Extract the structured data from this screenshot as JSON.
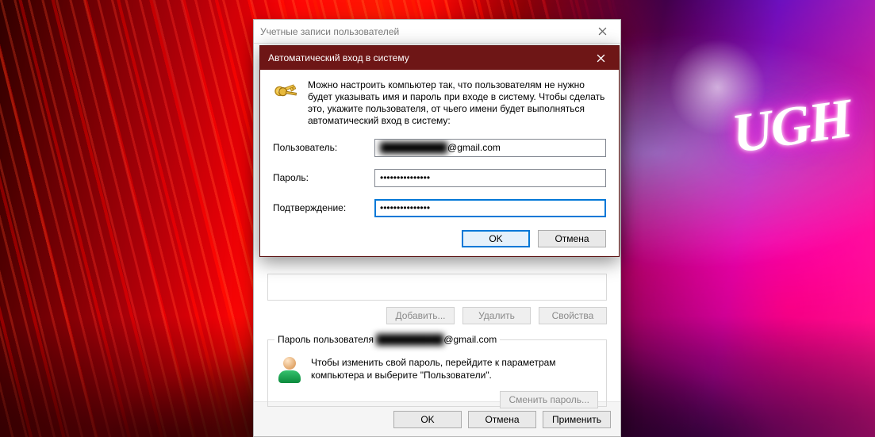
{
  "neon_sign": "UGH",
  "parent": {
    "title": "Учетные записи пользователей",
    "add": "Добавить...",
    "remove": "Удалить",
    "properties": "Свойства",
    "password_group_label_prefix": "Пароль пользователя ",
    "password_masked_user": "██████████",
    "password_group_label_suffix": "@gmail.com",
    "password_hint_text": "Чтобы изменить свой пароль, перейдите к параметрам компьютера и выберите \"Пользователи\".",
    "change_password": "Сменить пароль...",
    "ok": "OK",
    "cancel": "Отмена",
    "apply": "Применить"
  },
  "dialog": {
    "title": "Автоматический вход в систему",
    "intro": "Можно настроить компьютер так, что пользователям не нужно будет указывать имя и пароль при входе в систему. Чтобы сделать это, укажите пользователя, от чьего имени будет выполняться автоматический вход в систему:",
    "user_label": "Пользователь:",
    "user_value_visible": "@gmail.com",
    "password_label": "Пароль:",
    "password_value": "•••••••••••••••",
    "confirm_label": "Подтверждение:",
    "confirm_value": "•••••••••••••••",
    "ok": "OK",
    "cancel": "Отмена"
  }
}
